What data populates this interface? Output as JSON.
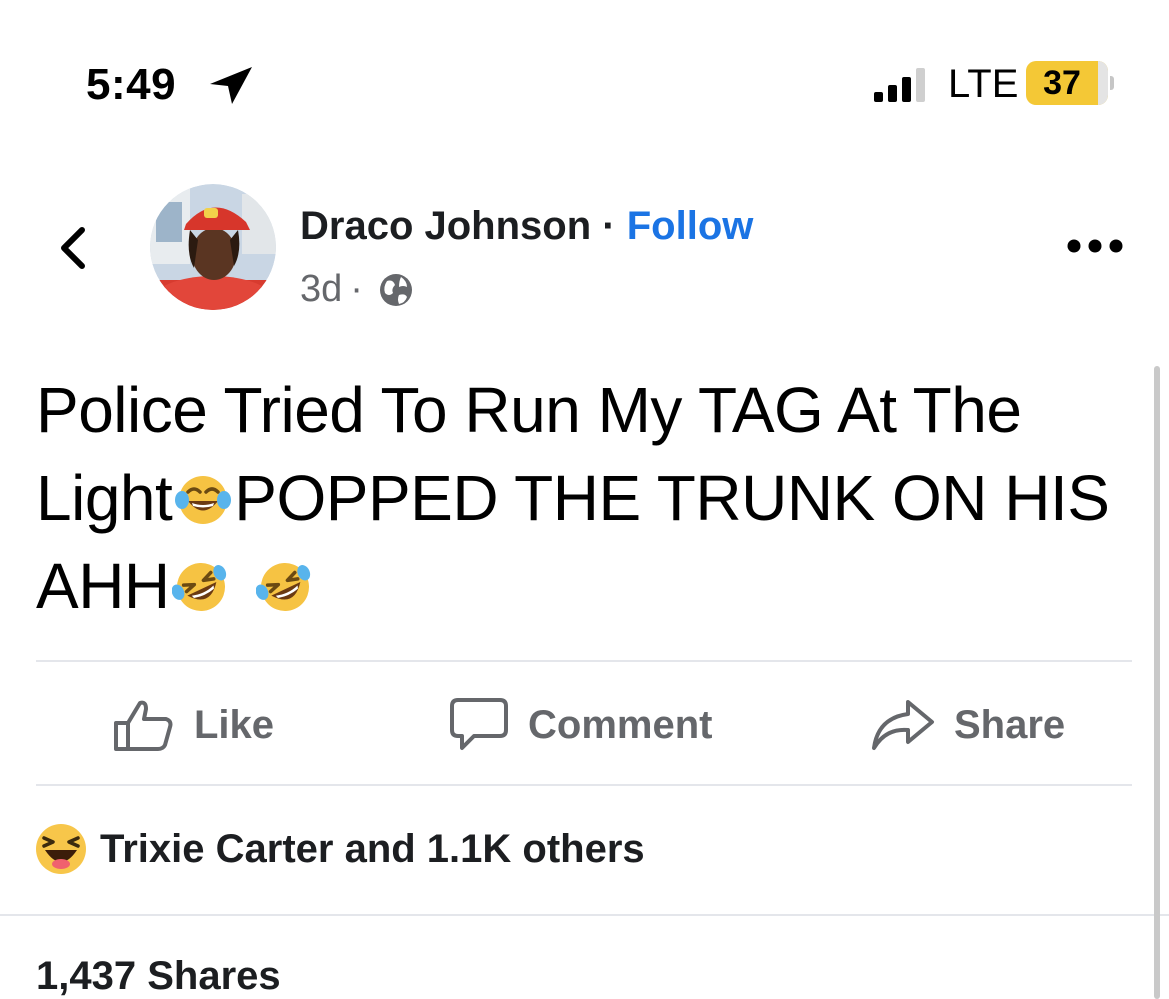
{
  "status_bar": {
    "time": "5:49",
    "network": "LTE",
    "battery": "37",
    "battery_color": "#f4c836"
  },
  "post": {
    "author": "Draco Johnson",
    "separator": "·",
    "follow": "Follow",
    "age": "3d",
    "meta_separator": "·",
    "text_parts": {
      "part1": "Police Tried To Run My TAG At The Light",
      "part2": "POPPED THE TRUNK ON HIS AHH"
    },
    "emojis": [
      "face-with-tears-of-joy",
      "rolling-on-the-floor-laughing",
      "rolling-on-the-floor-laughing"
    ]
  },
  "actions": {
    "like": "Like",
    "comment": "Comment",
    "share": "Share"
  },
  "reactions": {
    "summary": "Trixie Carter and 1.1K others",
    "icon": "haha-reaction-icon"
  },
  "shares": "1,437 Shares",
  "colors": {
    "link_blue": "#1b74e4",
    "muted_gray": "#65676b",
    "divider": "#e4e6eb"
  }
}
